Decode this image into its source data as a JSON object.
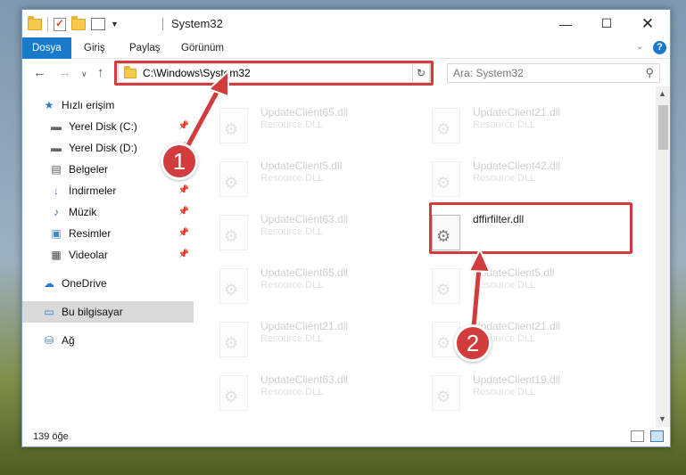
{
  "window": {
    "title": "System32"
  },
  "ribbon": {
    "tabs": [
      "Dosya",
      "Giriş",
      "Paylaş",
      "Görünüm"
    ]
  },
  "address": {
    "path": "C:\\Windows\\System32",
    "search_placeholder": "Ara: System32"
  },
  "nav": {
    "items": [
      {
        "label": "Hızlı erişim",
        "icon": "star-icon"
      },
      {
        "label": "Yerel Disk (C:)",
        "icon": "drive-icon",
        "pinned": true
      },
      {
        "label": "Yerel Disk (D:)",
        "icon": "drive-icon",
        "pinned": true
      },
      {
        "label": "Belgeler",
        "icon": "document-icon",
        "pinned": true
      },
      {
        "label": "İndirmeler",
        "icon": "download-icon",
        "pinned": true
      },
      {
        "label": "Müzik",
        "icon": "music-icon",
        "pinned": true
      },
      {
        "label": "Resimler",
        "icon": "pictures-icon",
        "pinned": true
      },
      {
        "label": "Videolar",
        "icon": "video-icon",
        "pinned": true
      },
      {
        "label": "OneDrive",
        "icon": "cloud-icon"
      },
      {
        "label": "Bu bilgisayar",
        "icon": "computer-icon",
        "selected": true
      },
      {
        "label": "Ağ",
        "icon": "network-icon"
      }
    ]
  },
  "files": {
    "left": [
      {
        "name": "UpdateClient65.dll",
        "type": "Resource DLL"
      },
      {
        "name": "UpdateClient5.dll",
        "type": "Resource DLL"
      },
      {
        "name": "UpdateClient63.dll",
        "type": "Resource DLL"
      },
      {
        "name": "UpdateClient65.dll",
        "type": "Resource DLL"
      },
      {
        "name": "UpdateClient21.dll",
        "type": "Resource DLL"
      },
      {
        "name": "UpdateClient63.dll",
        "type": "Resource DLL"
      }
    ],
    "right": [
      {
        "name": "UpdateClient21.dll",
        "type": "Resource DLL"
      },
      {
        "name": "UpdateClient42.dll",
        "type": "Resource DLL"
      },
      {
        "name": "dffirfilter.dll",
        "type": "",
        "highlighted": true
      },
      {
        "name": "UpdateClient5.dll",
        "type": "Resource DLL"
      },
      {
        "name": "UpdateClient21.dll",
        "type": "Resource DLL"
      },
      {
        "name": "UpdateClient19.dll",
        "type": "Resource DLL"
      }
    ]
  },
  "status": {
    "count": "139 öğe"
  },
  "annotations": {
    "badge1": "1",
    "badge2": "2",
    "color": "#d23c3c"
  }
}
